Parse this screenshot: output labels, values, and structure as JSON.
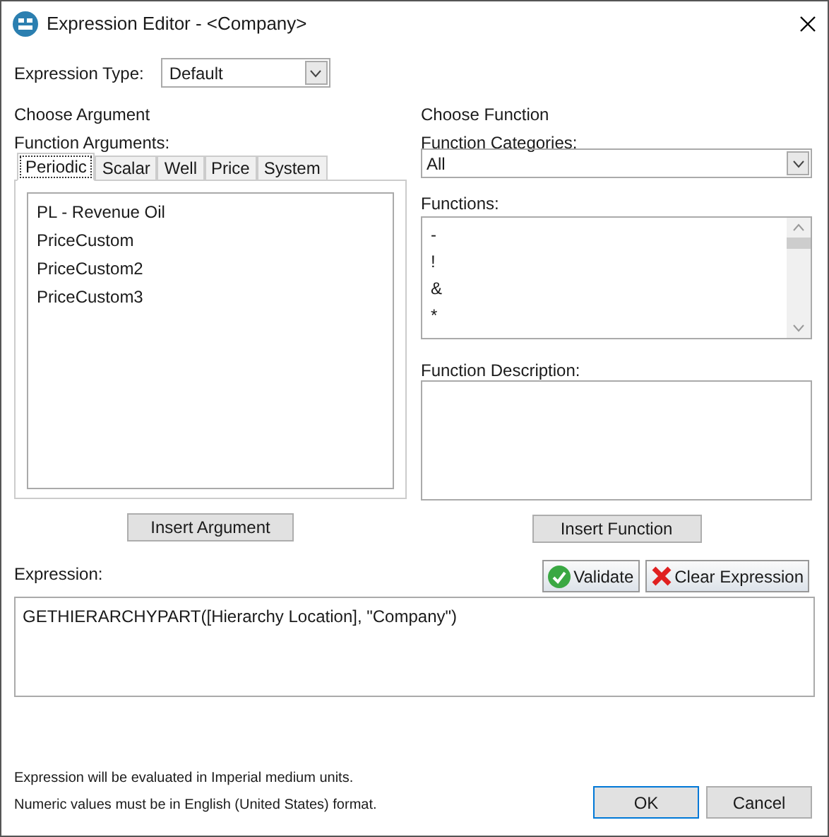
{
  "window": {
    "title": "Expression Editor - <Company>"
  },
  "expression_type": {
    "label": "Expression Type:",
    "value": "Default"
  },
  "argument_section": {
    "heading": "Choose Argument",
    "label": "Function Arguments:",
    "tabs": [
      {
        "label": "Periodic",
        "selected": true
      },
      {
        "label": "Scalar",
        "selected": false
      },
      {
        "label": "Well",
        "selected": false
      },
      {
        "label": "Price",
        "selected": false
      },
      {
        "label": "System",
        "selected": false
      }
    ],
    "items": [
      "PL - Revenue Oil",
      "PriceCustom",
      "PriceCustom2",
      "PriceCustom3"
    ],
    "button": "Insert Argument"
  },
  "function_section": {
    "heading": "Choose Function",
    "categories_label": "Function Categories:",
    "category": "All",
    "functions_label": "Functions:",
    "functions": [
      "-",
      "!",
      "&",
      "*"
    ],
    "description_label": "Function Description:",
    "button": "Insert Function"
  },
  "expression": {
    "label": "Expression:",
    "validate": "Validate",
    "clear": "Clear Expression",
    "value": "GETHIERARCHYPART([Hierarchy Location], \"Company\")"
  },
  "notes": [
    "Expression will be evaluated in Imperial medium units.",
    "Numeric values must be in English (United States) format."
  ],
  "buttons": [
    {
      "label": "OK",
      "selected": true
    },
    {
      "label": "Cancel",
      "selected": false
    }
  ]
}
